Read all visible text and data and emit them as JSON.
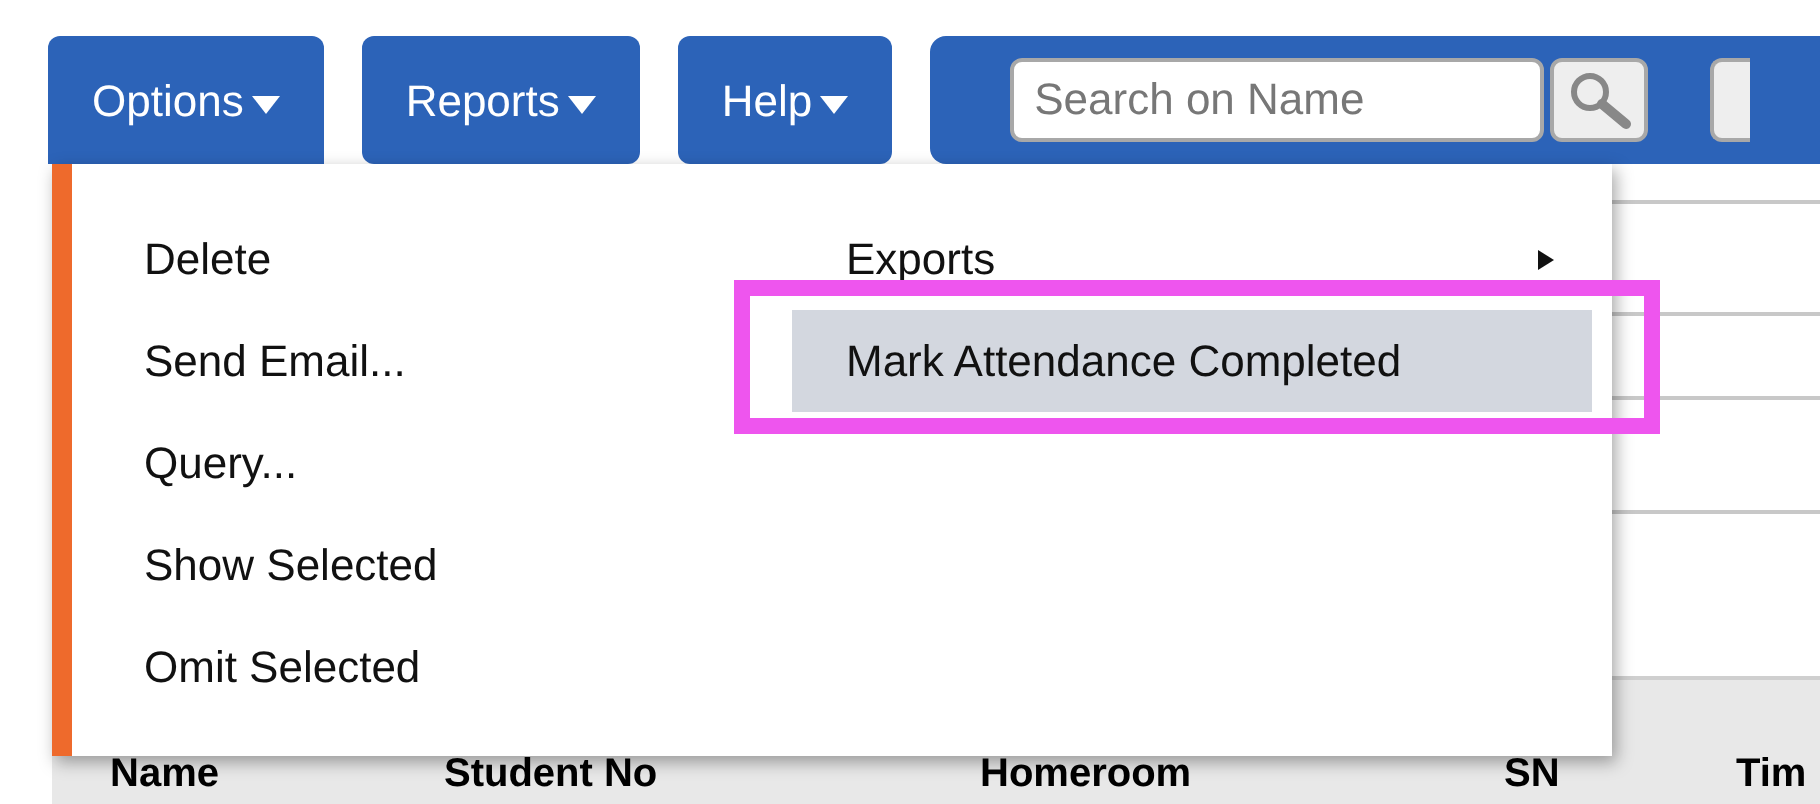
{
  "toolbar": {
    "menus": [
      {
        "label": "Options",
        "expanded": true
      },
      {
        "label": "Reports",
        "expanded": false
      },
      {
        "label": "Help",
        "expanded": false
      }
    ],
    "search": {
      "placeholder": "Search on Name"
    }
  },
  "menu": {
    "left_items": [
      {
        "label": "Delete",
        "highlighted": false,
        "submenu": false,
        "annotated": false
      },
      {
        "label": "Send Email...",
        "highlighted": false,
        "submenu": false,
        "annotated": false
      },
      {
        "label": "Query...",
        "highlighted": false,
        "submenu": false,
        "annotated": false
      },
      {
        "label": "Show Selected",
        "highlighted": false,
        "submenu": false,
        "annotated": false
      },
      {
        "label": "Omit Selected",
        "highlighted": false,
        "submenu": false,
        "annotated": false
      }
    ],
    "right_items": [
      {
        "label": "Exports",
        "highlighted": false,
        "submenu": true,
        "annotated": false
      },
      {
        "label": "Mark Attendance Completed",
        "highlighted": true,
        "submenu": false,
        "annotated": true
      }
    ]
  },
  "table": {
    "columns": [
      "Name",
      "Student No",
      "Homeroom",
      "SN",
      "Tim"
    ]
  }
}
